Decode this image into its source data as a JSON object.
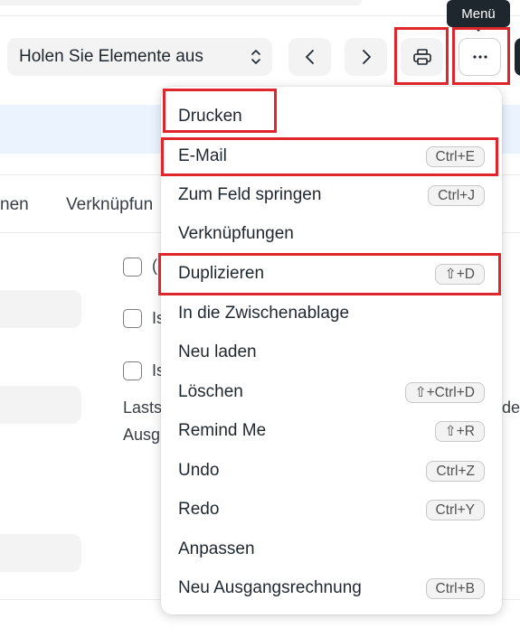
{
  "tooltip": {
    "text": "Menü"
  },
  "toolbar": {
    "select_label": "Holen Sie Elemente aus",
    "prev_icon": "chevron-left-icon",
    "next_icon": "chevron-right-icon",
    "print_icon": "printer-icon",
    "more_icon": "ellipsis-icon"
  },
  "background": {
    "tab_fragment_1": "nen",
    "tab_fragment_2": "Verknüpfun",
    "check_fragment_1": "(",
    "check_fragment_2": "Is",
    "check_fragment_3": "Is",
    "text_fragment_1": "Lasts",
    "text_fragment_2": "Ausg",
    "text_fragment_3": "de"
  },
  "menu": {
    "items": [
      {
        "label": "Drucken",
        "shortcut": ""
      },
      {
        "label": "E-Mail",
        "shortcut": "Ctrl+E"
      },
      {
        "label": "Zum Feld springen",
        "shortcut": "Ctrl+J"
      },
      {
        "label": "Verknüpfungen",
        "shortcut": ""
      },
      {
        "label": "Duplizieren",
        "shortcut": "⇧+D"
      },
      {
        "label": "In die Zwischenablage",
        "shortcut": ""
      },
      {
        "label": "Neu laden",
        "shortcut": ""
      },
      {
        "label": "Löschen",
        "shortcut": "⇧+Ctrl+D"
      },
      {
        "label": "Remind Me",
        "shortcut": "⇧+R"
      },
      {
        "label": "Undo",
        "shortcut": "Ctrl+Z"
      },
      {
        "label": "Redo",
        "shortcut": "Ctrl+Y"
      },
      {
        "label": "Anpassen",
        "shortcut": ""
      },
      {
        "label": "Neu Ausgangsrechnung",
        "shortcut": "Ctrl+B"
      }
    ]
  },
  "colors": {
    "highlight": "#e0262d",
    "band": "#ebf4fe",
    "tooltip_bg": "#1f272e"
  }
}
